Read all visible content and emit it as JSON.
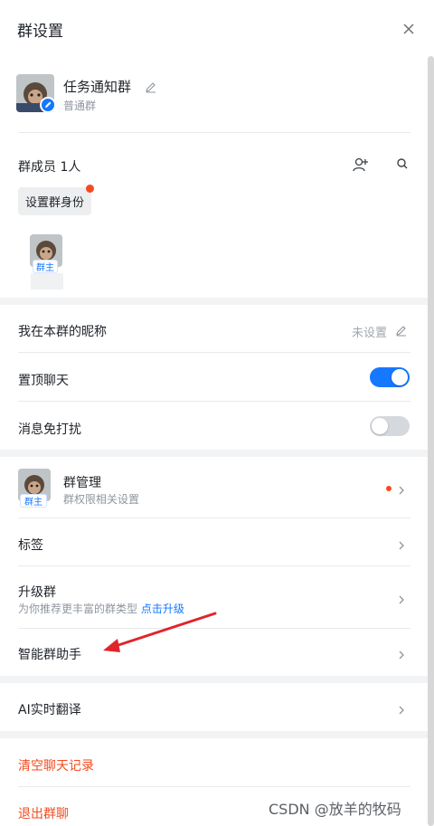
{
  "header": {
    "title": "群设置"
  },
  "group": {
    "name": "任务通知群",
    "type": "普通群"
  },
  "members": {
    "label": "群成员 1人",
    "role_button": "设置群身份",
    "owner_tag": "群主"
  },
  "settings": {
    "nickname_label": "我在本群的昵称",
    "nickname_value": "未设置",
    "pin_label": "置顶聊天",
    "pin_on": true,
    "mute_label": "消息免打扰",
    "mute_on": false
  },
  "management": {
    "title": "群管理",
    "subtitle": "群权限相关设置",
    "owner_tag": "群主"
  },
  "tags": {
    "label": "标签"
  },
  "upgrade": {
    "label": "升级群",
    "subtitle": "为你推荐更丰富的群类型",
    "link": "点击升级"
  },
  "assistant": {
    "label": "智能群助手"
  },
  "translate": {
    "label": "AI实时翻译"
  },
  "danger": {
    "clear_history": "清空聊天记录",
    "leave_group": "退出群聊"
  },
  "watermark": "CSDN @放羊的牧码",
  "icons": [
    "close-icon",
    "edit-icon",
    "pencil-icon",
    "add-member-icon",
    "search-icon",
    "chevron-right-icon"
  ],
  "colors": {
    "accent": "#1677ff",
    "danger": "#f54a1e",
    "annotation_arrow": "#e0242b"
  }
}
